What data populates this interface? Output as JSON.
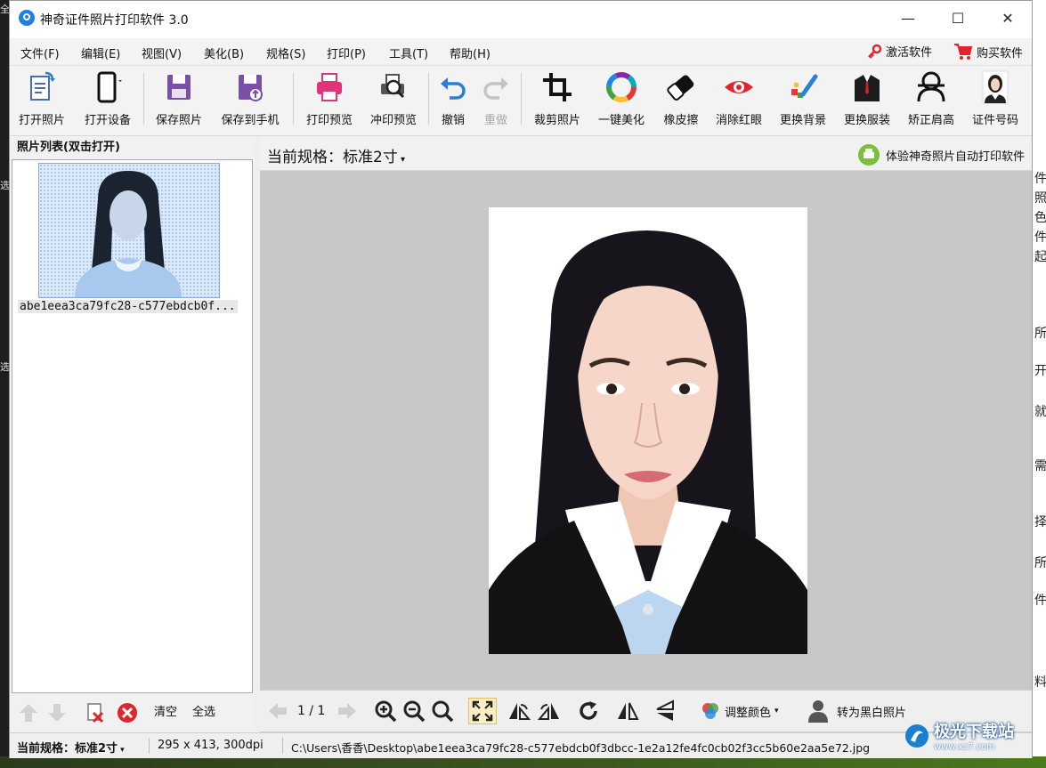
{
  "window": {
    "title": "神奇证件照片打印软件 3.0"
  },
  "menu": {
    "items": [
      "文件(F)",
      "编辑(E)",
      "视图(V)",
      "美化(B)",
      "规格(S)",
      "打印(P)",
      "工具(T)",
      "帮助(H)"
    ],
    "activate": "激活软件",
    "buy": "购买软件"
  },
  "toolbar": {
    "open_photo": "打开照片",
    "open_device": "打开设备",
    "save_photo": "保存照片",
    "save_to_phone": "保存到手机",
    "print_preview": "打印预览",
    "develop_preview": "冲印预览",
    "undo": "撤销",
    "redo": "重做",
    "crop": "裁剪照片",
    "beautify": "一键美化",
    "eraser": "橡皮擦",
    "red_eye": "消除红眼",
    "change_bg": "更换背景",
    "change_clothes": "更换服装",
    "fix_shoulder": "矫正肩高",
    "id_number": "证件号码"
  },
  "left_panel": {
    "title": "照片列表(双击打开)",
    "photos": [
      {
        "name": "abe1eea3ca79fc28-c577ebdcb0f..."
      }
    ],
    "clear": "清空",
    "select_all": "全选"
  },
  "main": {
    "spec_label": "当前规格：标准2寸",
    "promo": "体验神奇照片自动打印软件",
    "page_indicator": "1 / 1",
    "adjust_color": "调整颜色",
    "to_bw": "转为黑白照片"
  },
  "status": {
    "spec": "当前规格：标准2寸",
    "size": "295 x 413, 300dpi",
    "path": "C:\\Users\\香香\\Desktop\\abe1eea3ca79fc28-c577ebdcb0f3dbcc-1e2a12fe4fc0cb02f3cc5b60e2aa5e72.jpg"
  },
  "watermark": {
    "title": "极光下载站",
    "url": "www.xz7.com"
  },
  "desktop_fragments": {
    "left": [
      "全",
      "选",
      "选"
    ],
    "right": [
      "件",
      "照",
      "色",
      "件",
      "起",
      "所",
      "开",
      "就",
      "需",
      "择",
      "所",
      "件",
      "料"
    ]
  },
  "colors": {
    "accent": "#1f7de6",
    "purple": "#7b4fa5",
    "red": "#e0252b",
    "canvas": "#c8c8c8"
  }
}
